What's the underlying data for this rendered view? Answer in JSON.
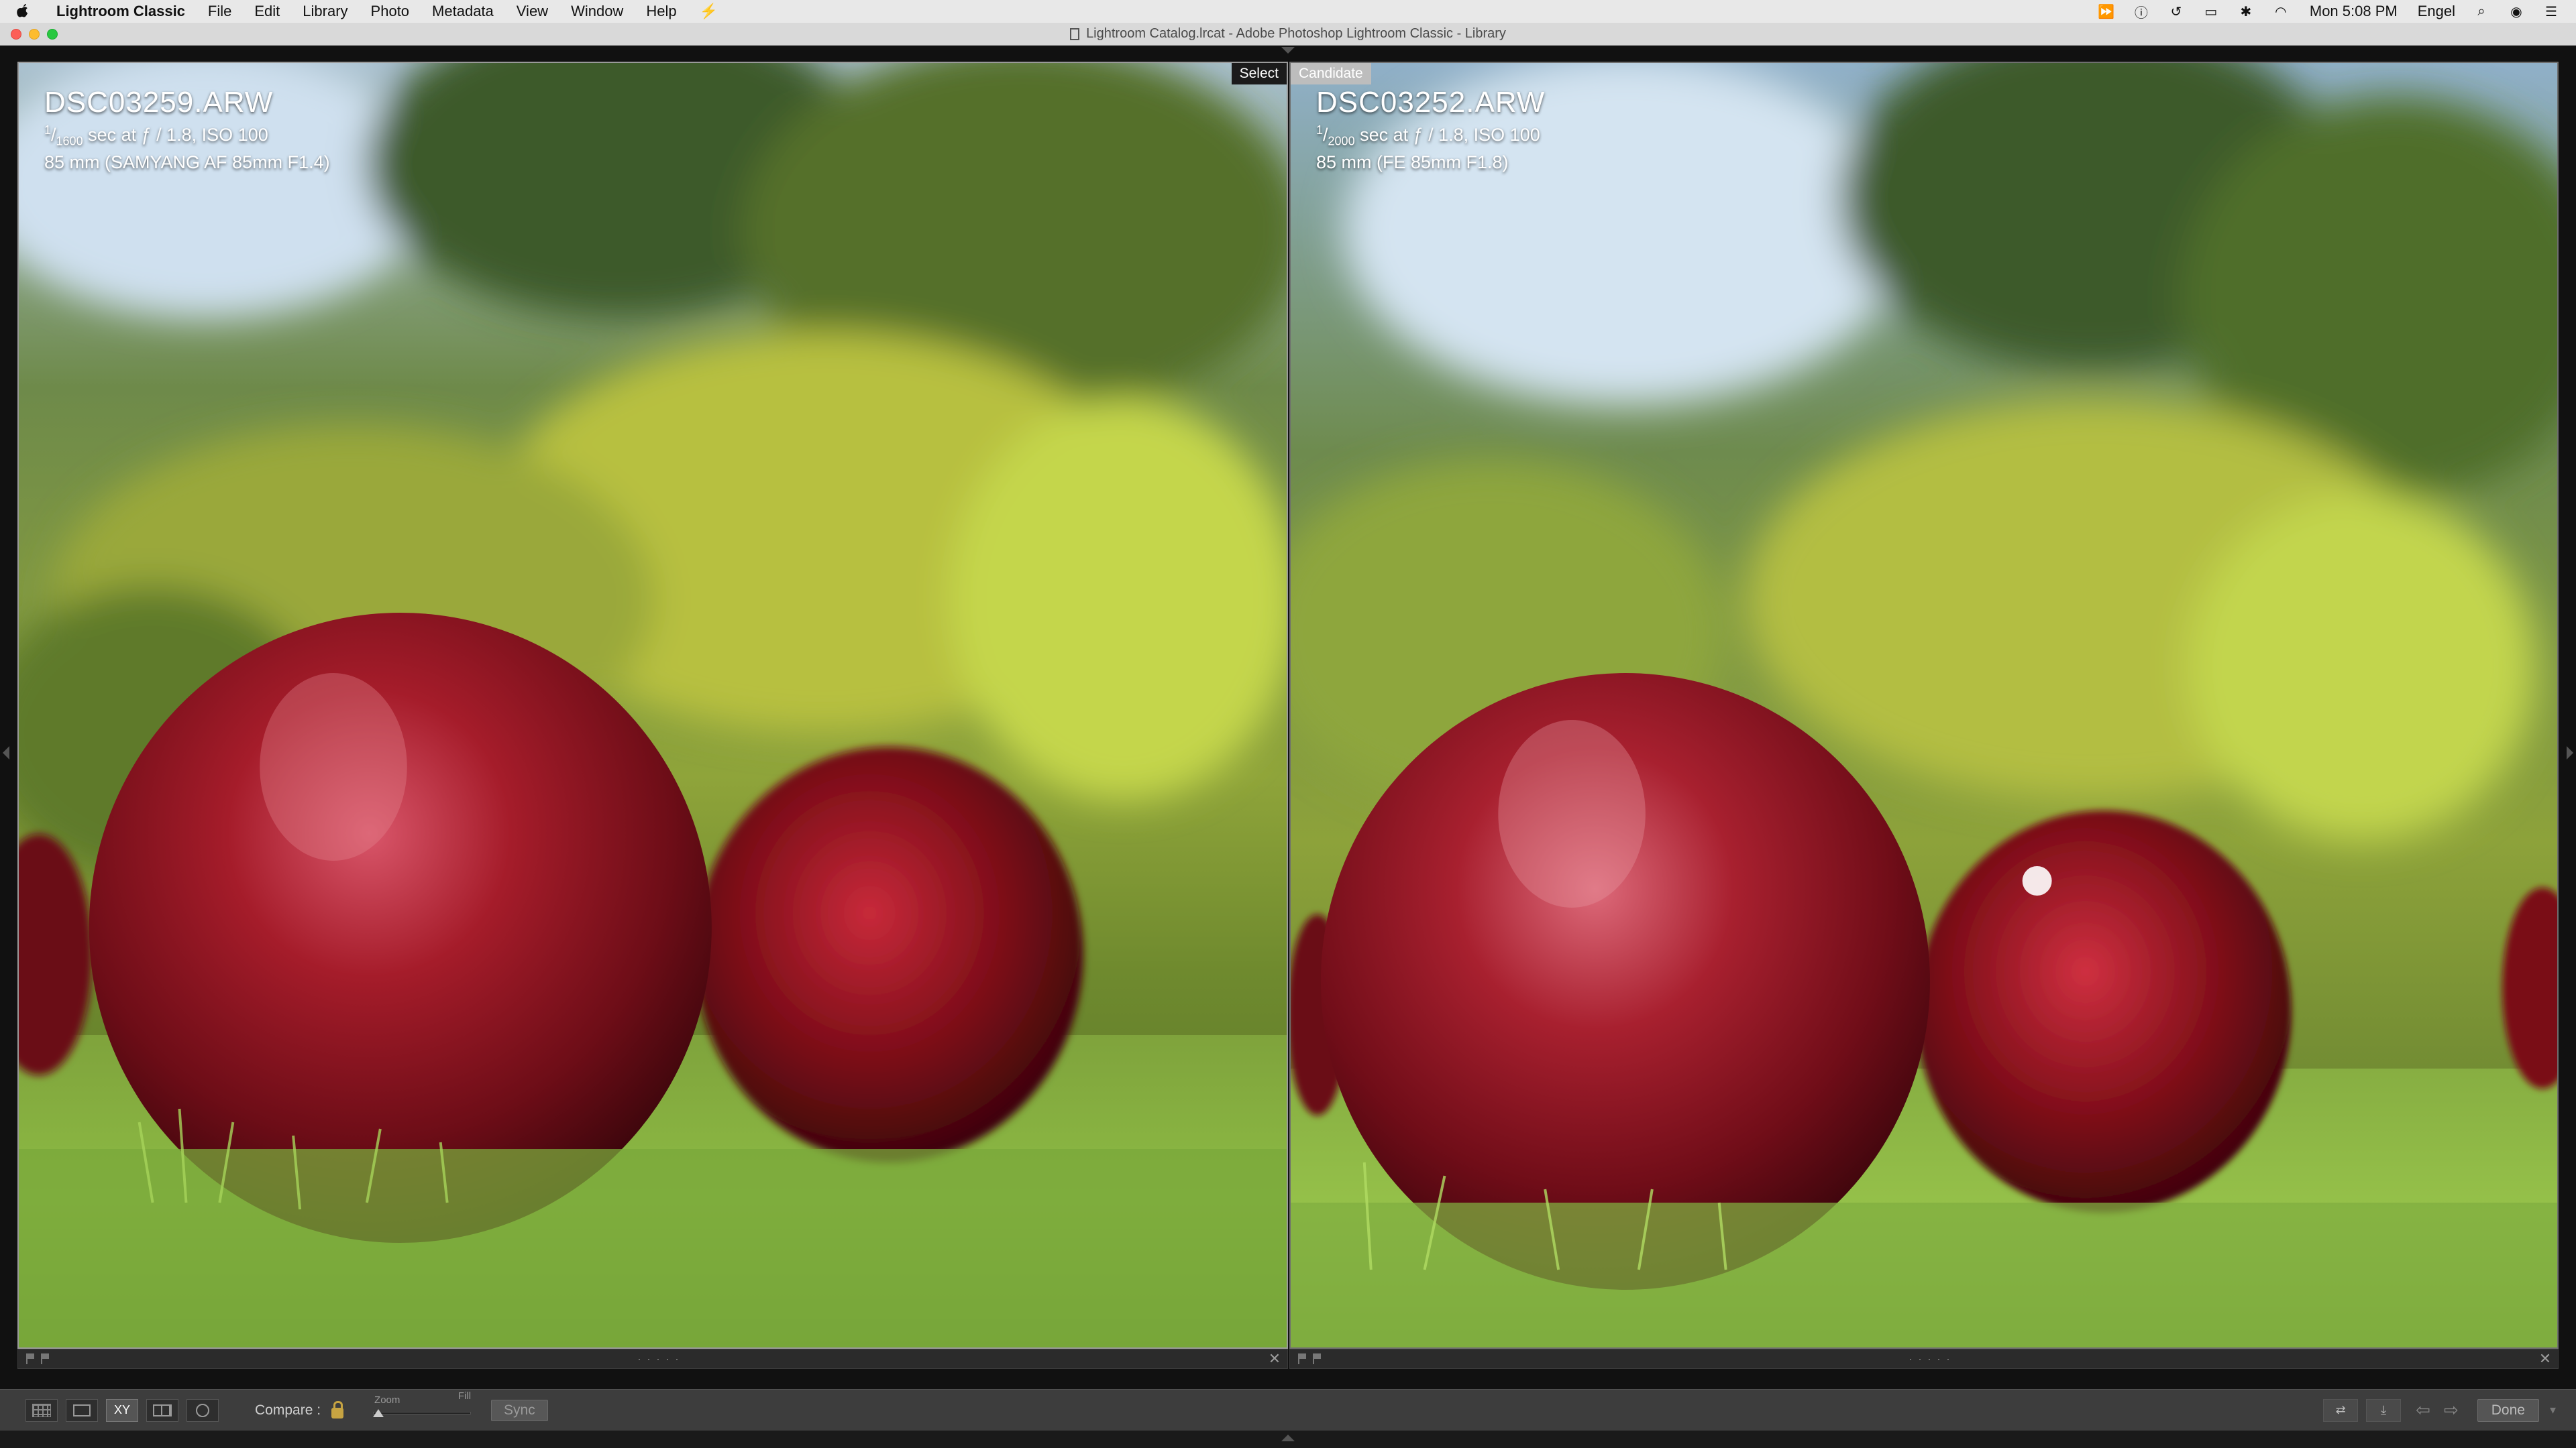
{
  "menubar": {
    "app_name": "Lightroom Classic",
    "items": [
      "File",
      "Edit",
      "Library",
      "Photo",
      "Metadata",
      "View",
      "Window",
      "Help"
    ],
    "clock": "Mon 5:08 PM",
    "user": "Engel"
  },
  "window": {
    "title": "Lightroom Catalog.lrcat - Adobe Photoshop Lightroom Classic - Library"
  },
  "compare": {
    "left": {
      "tag": "Select",
      "filename": "DSC03259.ARW",
      "shutter_num": "1",
      "shutter_den": "1600",
      "exposure_rest": " sec at ƒ / 1.8, ISO 100",
      "lens_line": "85 mm (SAMYANG AF 85mm F1.4)"
    },
    "right": {
      "tag": "Candidate",
      "filename": "DSC03252.ARW",
      "shutter_num": "1",
      "shutter_den": "2000",
      "exposure_rest": " sec at ƒ / 1.8, ISO 100",
      "lens_line": "85 mm (FE 85mm F1.8)"
    }
  },
  "toolbar": {
    "compare_label": "Compare :",
    "zoom_label": "Zoom",
    "fill_label": "Fill",
    "sync_label": "Sync",
    "done_label": "Done",
    "xy_label": "XY"
  },
  "colors": {
    "apple_red": "#9d1420",
    "grass_green": "#7fb23c",
    "foliage_yellow_green": "#b7c040",
    "sky_blue": "#cfe0ef"
  }
}
